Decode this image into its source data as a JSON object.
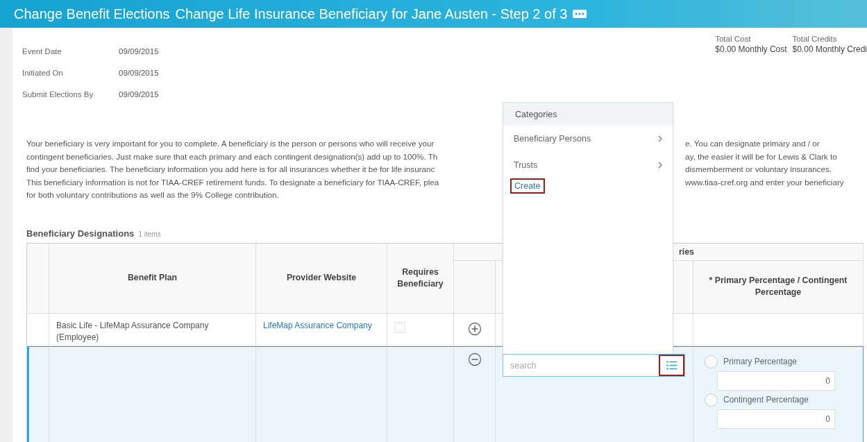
{
  "header": {
    "title": "Change Benefit Elections",
    "subtitle": "Change Life Insurance Beneficiary for Jane Austen - Step 2 of 3"
  },
  "summary": [
    {
      "label": "Event Date",
      "value": "09/09/2015"
    },
    {
      "label": "Initiated On",
      "value": "09/09/2015"
    },
    {
      "label": "Submit Elections By",
      "value": "09/09/2015"
    }
  ],
  "totals": [
    {
      "label": "Total Cost",
      "value": "$0.00 Monthly Cost"
    },
    {
      "label": "Total Credits",
      "value": "$0.00 Monthly Credi"
    }
  ],
  "intro": [
    {
      "left": "Your beneficiary is very important for you to complete. A beneficiary is the person or persons who will receive your",
      "right": "e. You can designate primary and / or"
    },
    {
      "left": "contingent beneficiaries. Just make sure that each primary and each contingent designation(s) add up to 100%. Th",
      "right": "ay, the easier it will be for Lewis & Clark to"
    },
    {
      "left": "find your beneficiaries. The beneficiary information you add here is for all  insurances whether it be for life insuranc",
      "right": "dismemberment or voluntary insurances."
    },
    {
      "left": "This beneficiary information is not for TIAA-CREF retirement funds. To designate a beneficiary for TIAA-CREF, plea",
      "right": "www.tiaa-cref.org and enter your beneficiary"
    },
    {
      "left": "for both voluntary contributions as well as the 9% College contribution."
    }
  ],
  "section": {
    "title": "Beneficiary Designations",
    "count": "1 items"
  },
  "table": {
    "group_header": "ries",
    "columns": [
      "Benefit Plan",
      "Provider Website",
      "Requires Beneficiary",
      "* Primary Percentage / Contingent Percentage"
    ],
    "plan_row": {
      "plan": "Basic Life - LifeMap Assurance Company (Employee)",
      "provider": "LifeMap Assurance Company",
      "requires_beneficiary": false
    },
    "beneficiary_row": {
      "search_placeholder": "search",
      "options": [
        {
          "label": "Primary Percentage",
          "selected": false,
          "value": "0"
        },
        {
          "label": "Contingent Percentage",
          "selected": false,
          "value": "0"
        }
      ]
    }
  },
  "popup": {
    "header": "Categories",
    "items": [
      {
        "label": "Beneficiary Persons",
        "kind": "submenu",
        "highlighted": false
      },
      {
        "label": "Trusts",
        "kind": "submenu",
        "highlighted": false
      },
      {
        "label": "Create",
        "kind": "link",
        "highlighted": true
      }
    ],
    "list_button_highlighted": true
  }
}
